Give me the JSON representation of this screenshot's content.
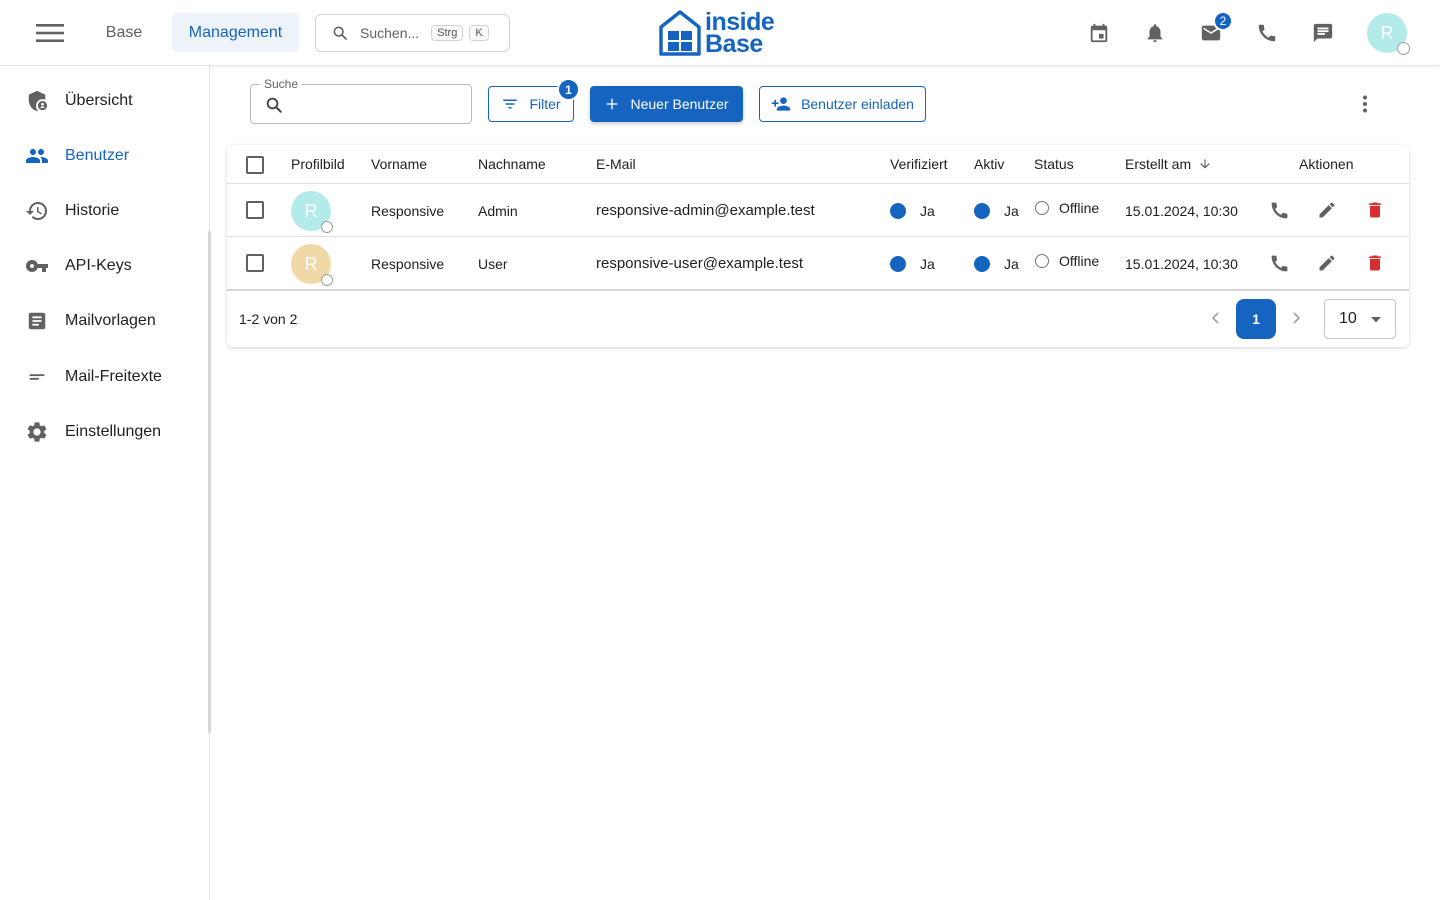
{
  "header": {
    "tabs": [
      {
        "label": "Base",
        "active": false
      },
      {
        "label": "Management",
        "active": true
      }
    ],
    "search": {
      "placeholder": "Suchen...",
      "shortcut_modifier": "Strg",
      "shortcut_key": "K"
    },
    "logo": {
      "line1": "inside",
      "line2": "Base"
    },
    "icons": [
      "calendar-icon",
      "bell-icon",
      "mail-icon",
      "phone-icon",
      "chat-icon"
    ],
    "mail_badge": "2",
    "avatar_initial": "R"
  },
  "sidebar": {
    "items": [
      {
        "label": "Übersicht",
        "icon": "shield-user-icon",
        "active": false
      },
      {
        "label": "Benutzer",
        "icon": "people-icon",
        "active": true
      },
      {
        "label": "Historie",
        "icon": "history-icon",
        "active": false
      },
      {
        "label": "API-Keys",
        "icon": "key-icon",
        "active": false
      },
      {
        "label": "Mailvorlagen",
        "icon": "document-icon",
        "active": false
      },
      {
        "label": "Mail-Freitexte",
        "icon": "short-text-icon",
        "active": false
      },
      {
        "label": "Einstellungen",
        "icon": "gear-icon",
        "active": false
      }
    ]
  },
  "toolbar": {
    "search_label": "Suche",
    "search_value": "",
    "filter_label": "Filter",
    "filter_badge": "1",
    "new_user_label": "Neuer Benutzer",
    "invite_label": "Benutzer einladen"
  },
  "table": {
    "columns": {
      "profile": "Profilbild",
      "firstname": "Vorname",
      "lastname": "Nachname",
      "email": "E-Mail",
      "verified": "Verifiziert",
      "active": "Aktiv",
      "status": "Status",
      "created": "Erstellt am",
      "actions": "Aktionen"
    },
    "rows": [
      {
        "initial": "R",
        "avatar_color": "#b2ebe9",
        "firstname": "Responsive",
        "lastname": "Admin",
        "email": "responsive-admin@example.test",
        "verified": "Ja",
        "active": "Ja",
        "status": "Offline",
        "created": "15.01.2024, 10:30"
      },
      {
        "initial": "R",
        "avatar_color": "#f0d9a6",
        "firstname": "Responsive",
        "lastname": "User",
        "email": "responsive-user@example.test",
        "verified": "Ja",
        "active": "Ja",
        "status": "Offline",
        "created": "15.01.2024, 10:30"
      }
    ],
    "footer": {
      "range_text": "1-2 von 2",
      "current_page": "1",
      "page_size": "10"
    }
  },
  "colors": {
    "primary": "#1565c0",
    "delete": "#d32f2f",
    "icon_gray": "#616161"
  }
}
